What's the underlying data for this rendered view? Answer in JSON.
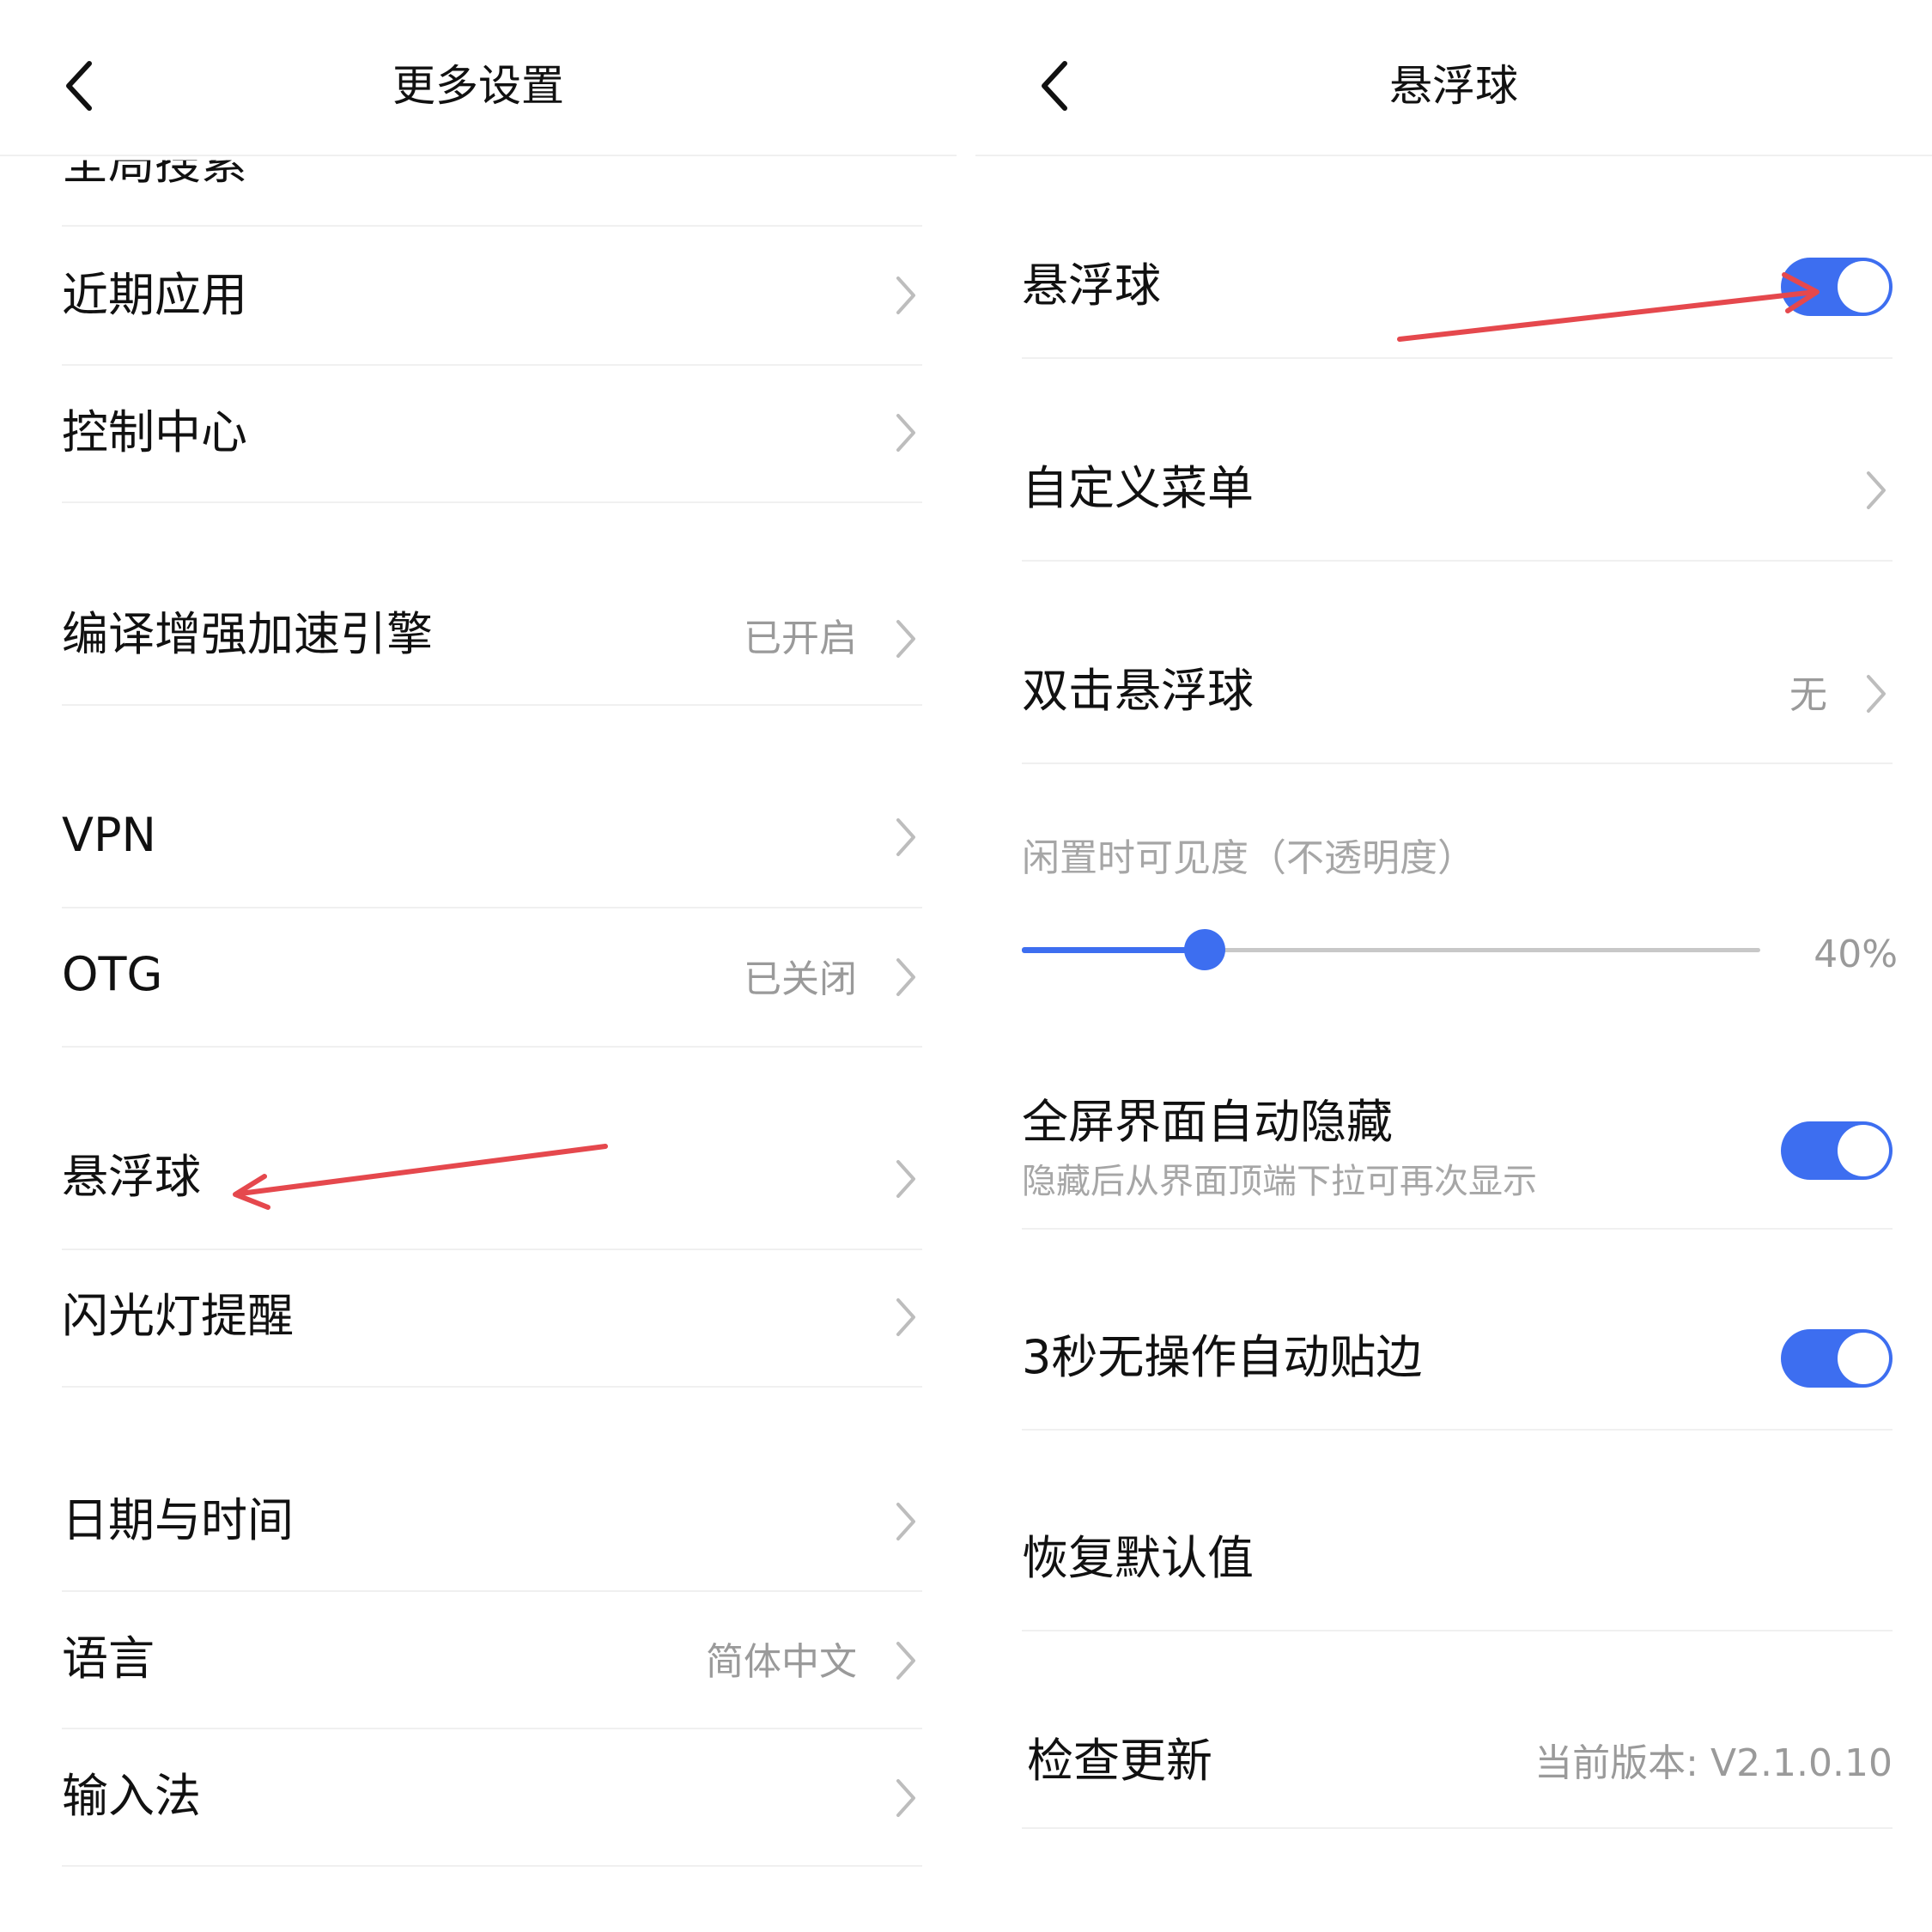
{
  "accent_color": "#3d6ef0",
  "annotation_color": "#e5484d",
  "left": {
    "title": "更多设置",
    "partial_top_item": "全局搜索",
    "items": [
      {
        "label": "近期应用",
        "value": ""
      },
      {
        "label": "控制中心",
        "value": ""
      },
      {
        "label": "编译增强加速引擎",
        "value": "已开启"
      },
      {
        "label": "VPN",
        "value": ""
      },
      {
        "label": "OTG",
        "value": "已关闭"
      },
      {
        "label": "悬浮球",
        "value": ""
      },
      {
        "label": "闪光灯提醒",
        "value": ""
      },
      {
        "label": "日期与时间",
        "value": ""
      },
      {
        "label": "语言",
        "value": "简体中文"
      },
      {
        "label": "输入法",
        "value": ""
      }
    ]
  },
  "right": {
    "title": "悬浮球",
    "floating_ball": {
      "label": "悬浮球",
      "enabled": true
    },
    "custom_menu": {
      "label": "自定义菜单"
    },
    "double_tap": {
      "label": "双击悬浮球",
      "value": "无"
    },
    "idle_visibility": {
      "label": "闲置时可见度（不透明度）",
      "value_text": "40%",
      "value": 0.4
    },
    "fullscreen_hide": {
      "label": "全屏界面自动隐藏",
      "sublabel": "隐藏后从界面顶端下拉可再次显示",
      "enabled": true
    },
    "auto_edge": {
      "label": "3秒无操作自动贴边",
      "enabled": true
    },
    "restore_default": {
      "label": "恢复默认值"
    },
    "check_update": {
      "label": "检查更新",
      "value": "当前版本: V2.1.0.10"
    }
  }
}
